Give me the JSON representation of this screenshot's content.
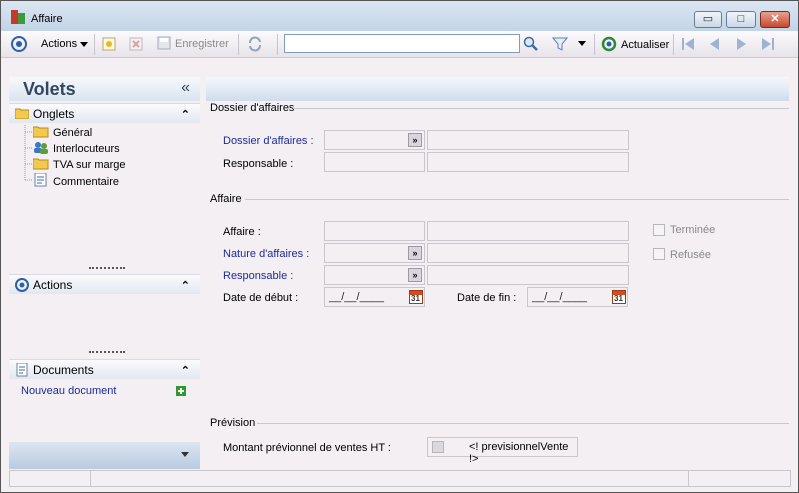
{
  "window": {
    "title": "Affaire",
    "minimize_glyph": "▭",
    "maximize_glyph": "□",
    "close_glyph": "✕"
  },
  "toolbar": {
    "actions_label": "Actions",
    "save_label": "Enregistrer",
    "search_value": "",
    "refresh_label": "Actualiser",
    "icons": [
      "target-icon",
      "new-icon",
      "delete-icon",
      "save-icon",
      "sync-icon",
      "magnifier-icon",
      "filter-icon",
      "refresh-icon",
      "first-icon",
      "prev-icon",
      "next-icon",
      "last-icon"
    ]
  },
  "left": {
    "volets_title": "Volets",
    "collapse_glyph": "«",
    "onglets_label": "Onglets",
    "tabs": [
      "Général",
      "Interlocuteurs",
      "TVA sur marge",
      "Commentaire"
    ],
    "actions_label": "Actions",
    "documents_label": "Documents",
    "new_document_label": "Nouveau document",
    "up_glyph": "⌃",
    "down_glyph": "⌄"
  },
  "form": {
    "dossier_group": "Dossier d'affaires",
    "dossier_label": "Dossier d'affaires :",
    "responsable1_label": "Responsable :",
    "affaire_group": "Affaire",
    "affaire_label": "Affaire :",
    "nature_label": "Nature d'affaires :",
    "responsable2_label": "Responsable :",
    "date_debut_label": "Date de début :",
    "date_debut_value": "__/__/____",
    "date_fin_label": "Date de fin :",
    "date_fin_value": "__/__/____",
    "calendar_day": "31",
    "terminee_label": "Terminée",
    "refusee_label": "Refusée",
    "prevision_group": "Prévision",
    "montant_label": "Montant prévionnel de ventes HT :",
    "montant_value": "<! previsionnelVente !>"
  },
  "colors": {
    "link": "#1c2b9c",
    "accent": "#d9e4f0",
    "add_green": "#2e9a2e"
  }
}
